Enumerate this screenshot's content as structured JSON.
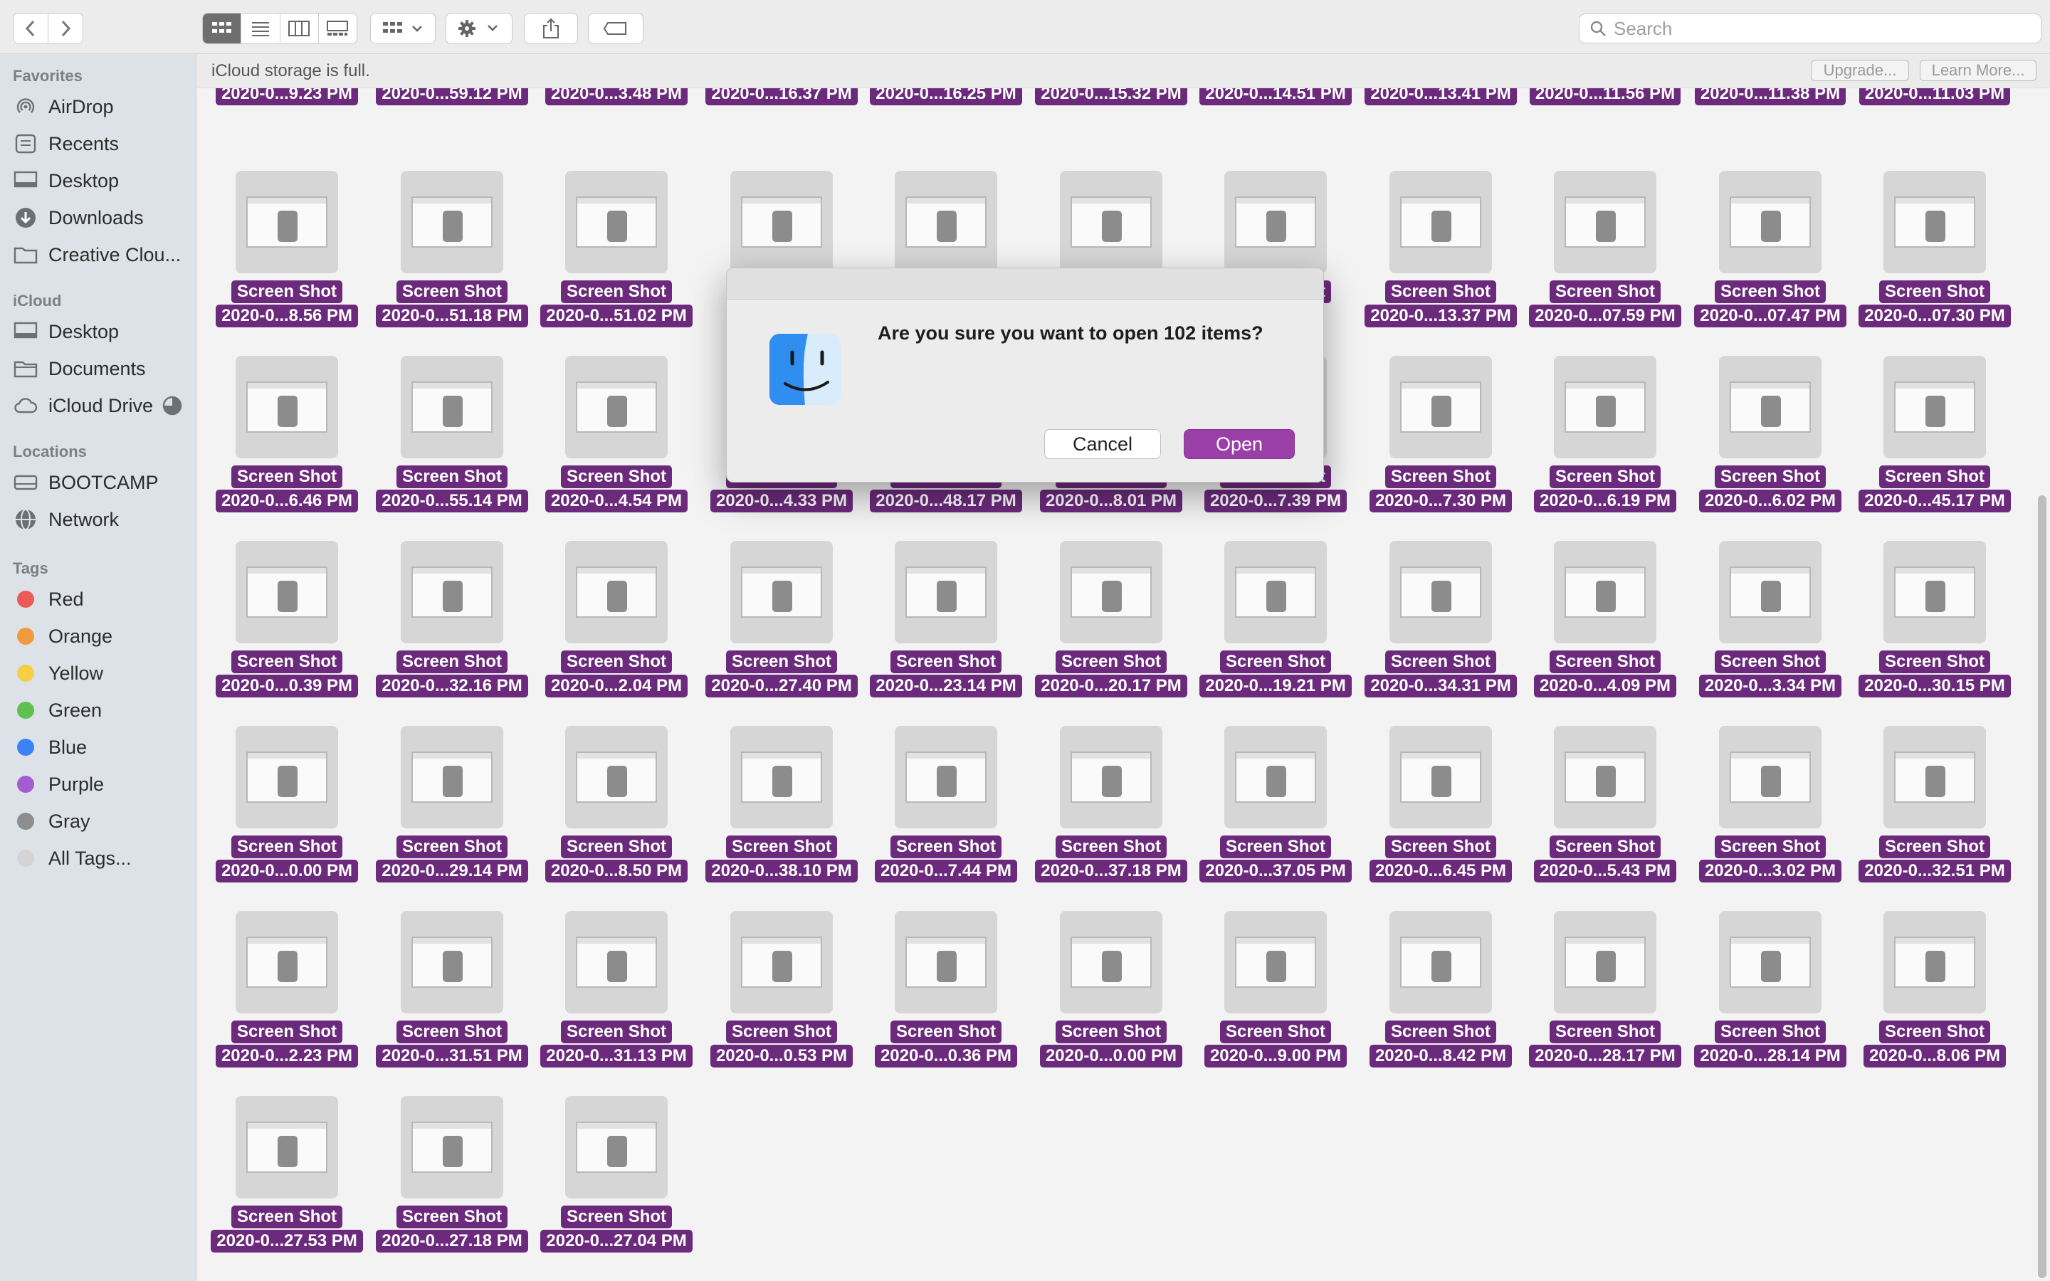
{
  "toolbar": {
    "back_icon": "chevron-left-icon",
    "forward_icon": "chevron-right-icon",
    "search_placeholder": "Search"
  },
  "sidebar": {
    "favorites_header": "Favorites",
    "favorites": [
      {
        "label": "AirDrop",
        "icon": "airdrop-icon"
      },
      {
        "label": "Recents",
        "icon": "clock-icon"
      },
      {
        "label": "Desktop",
        "icon": "desktop-icon"
      },
      {
        "label": "Downloads",
        "icon": "download-icon"
      },
      {
        "label": "Creative Clou...",
        "icon": "folder-icon"
      }
    ],
    "icloud_header": "iCloud",
    "icloud": [
      {
        "label": "Desktop",
        "icon": "desktop-icon"
      },
      {
        "label": "Documents",
        "icon": "document-icon"
      },
      {
        "label": "iCloud Drive",
        "icon": "cloud-icon"
      }
    ],
    "locations_header": "Locations",
    "locations": [
      {
        "label": "BOOTCAMP",
        "icon": "drive-icon"
      },
      {
        "label": "Network",
        "icon": "globe-icon"
      }
    ],
    "tags_header": "Tags",
    "tags": [
      {
        "label": "Red",
        "color": "#ec5a58"
      },
      {
        "label": "Orange",
        "color": "#f19a3e"
      },
      {
        "label": "Yellow",
        "color": "#f5cf45"
      },
      {
        "label": "Green",
        "color": "#5dc051"
      },
      {
        "label": "Blue",
        "color": "#3a82f6"
      },
      {
        "label": "Purple",
        "color": "#a55bd1"
      },
      {
        "label": "Gray",
        "color": "#8d8d8d"
      },
      {
        "label": "All Tags...",
        "color": "#d4d4d4"
      }
    ]
  },
  "banner": {
    "message": "iCloud storage is full.",
    "upgrade": "Upgrade...",
    "learn_more": "Learn More..."
  },
  "files": {
    "name_line1": "Screen Shot",
    "rows": [
      [
        "2020-0...9.23 PM",
        "2020-0...59.12 PM",
        "2020-0...3.48 PM",
        "2020-0...16.37 PM",
        "2020-0...16.25 PM",
        "2020-0...15.32 PM",
        "2020-0...14.51 PM",
        "2020-0...13.41 PM",
        "2020-0...11.56 PM",
        "2020-0...11.38 PM",
        "2020-0...11.03 PM"
      ],
      [
        "2020-0...8.56 PM",
        "2020-0...51.18 PM",
        "2020-0...51.02 PM",
        "",
        "",
        "",
        "",
        "2020-0...13.37 PM",
        "2020-0...07.59 PM",
        "2020-0...07.47 PM",
        "2020-0...07.30 PM"
      ],
      [
        "2020-0...6.46 PM",
        "2020-0...55.14 PM",
        "2020-0...4.54 PM",
        "2020-0...4.33 PM",
        "2020-0...48.17 PM",
        "2020-0...8.01 PM",
        "2020-0...7.39 PM",
        "2020-0...7.30 PM",
        "2020-0...6.19 PM",
        "2020-0...6.02 PM",
        "2020-0...45.17 PM"
      ],
      [
        "2020-0...0.39 PM",
        "2020-0...32.16 PM",
        "2020-0...2.04 PM",
        "2020-0...27.40 PM",
        "2020-0...23.14 PM",
        "2020-0...20.17 PM",
        "2020-0...19.21 PM",
        "2020-0...34.31 PM",
        "2020-0...4.09 PM",
        "2020-0...3.34 PM",
        "2020-0...30.15 PM"
      ],
      [
        "2020-0...0.00 PM",
        "2020-0...29.14 PM",
        "2020-0...8.50 PM",
        "2020-0...38.10 PM",
        "2020-0...7.44 PM",
        "2020-0...37.18 PM",
        "2020-0...37.05 PM",
        "2020-0...6.45 PM",
        "2020-0...5.43 PM",
        "2020-0...3.02 PM",
        "2020-0...32.51 PM"
      ],
      [
        "2020-0...2.23 PM",
        "2020-0...31.51 PM",
        "2020-0...31.13 PM",
        "2020-0...0.53 PM",
        "2020-0...0.36 PM",
        "2020-0...0.00 PM",
        "2020-0...9.00 PM",
        "2020-0...8.42 PM",
        "2020-0...28.17 PM",
        "2020-0...28.14 PM",
        "2020-0...8.06 PM"
      ],
      [
        "2020-0...27.53 PM",
        "2020-0...27.18 PM",
        "2020-0...27.04 PM"
      ]
    ]
  },
  "dialog": {
    "question": "Are you sure you want to open 102 items?",
    "cancel": "Cancel",
    "open": "Open",
    "icon": "finder-icon"
  },
  "colors": {
    "selection": "#6c2a7c",
    "open_button": "#9b3fa8"
  }
}
